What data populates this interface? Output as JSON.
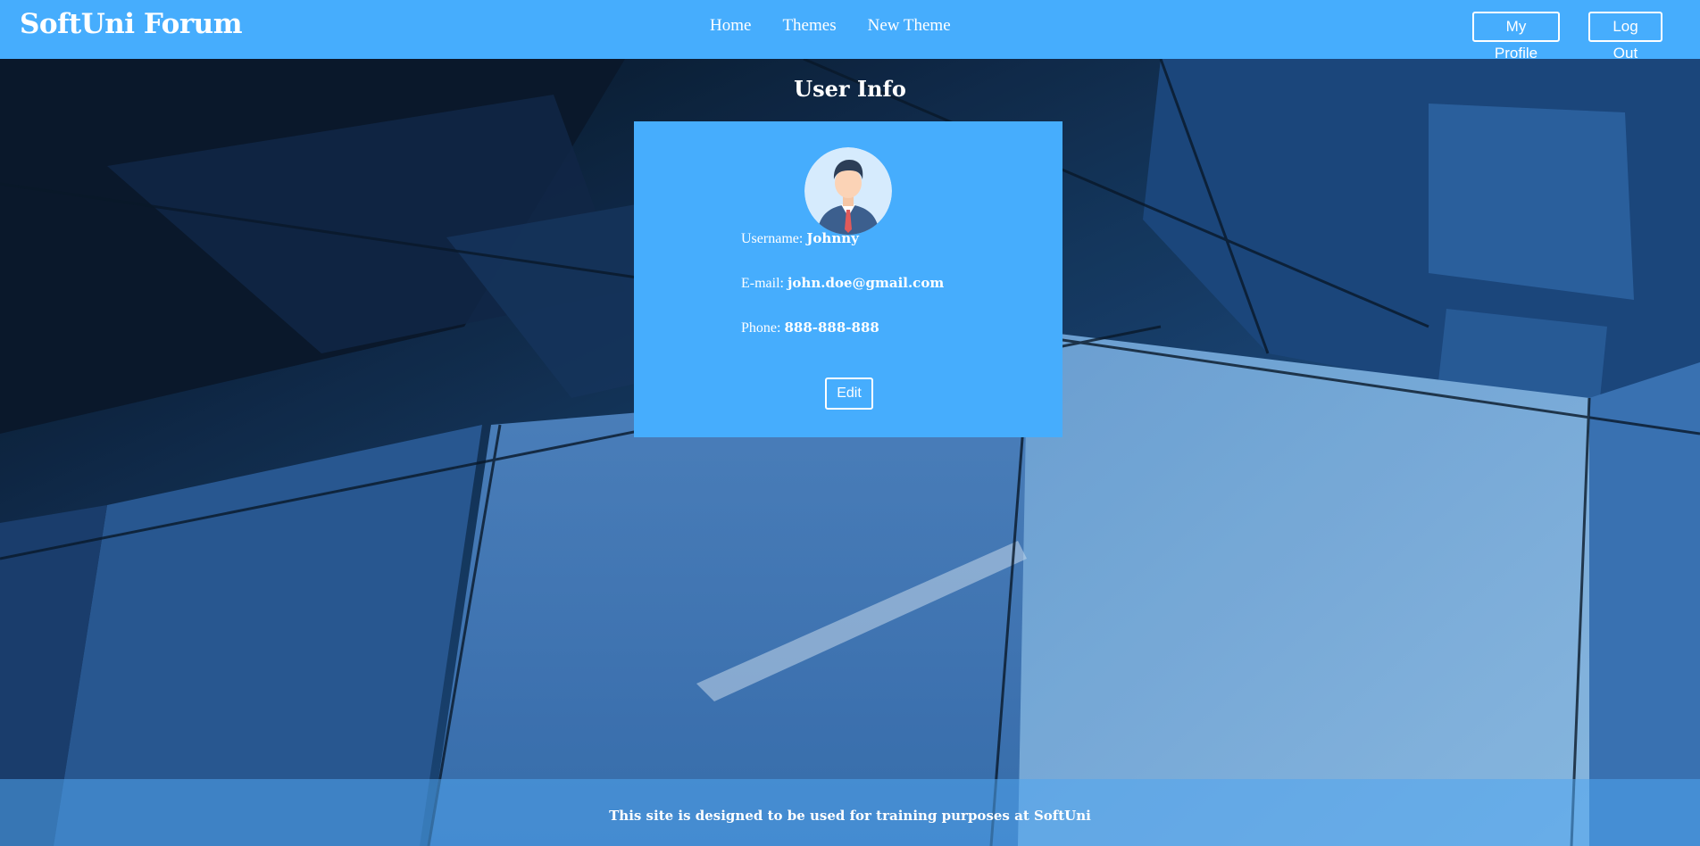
{
  "header": {
    "brand": "SoftUni Forum",
    "nav": [
      "Home",
      "Themes",
      "New Theme"
    ],
    "my_profile_label": "My Profile",
    "logout_label": "Log Out"
  },
  "page": {
    "title": "User Info"
  },
  "profile": {
    "username_label": "Username:",
    "username": "Johnny",
    "email_label": "E-mail:",
    "email": "john.doe@gmail.com",
    "phone_label": "Phone:",
    "phone": "888-888-888",
    "edit_label": "Edit",
    "avatar_icon": "user-avatar-icon"
  },
  "footer": {
    "text": "This site is designed to be used for training purposes at SoftUni"
  },
  "colors": {
    "accent": "#46adfd",
    "text": "#ffffff"
  }
}
